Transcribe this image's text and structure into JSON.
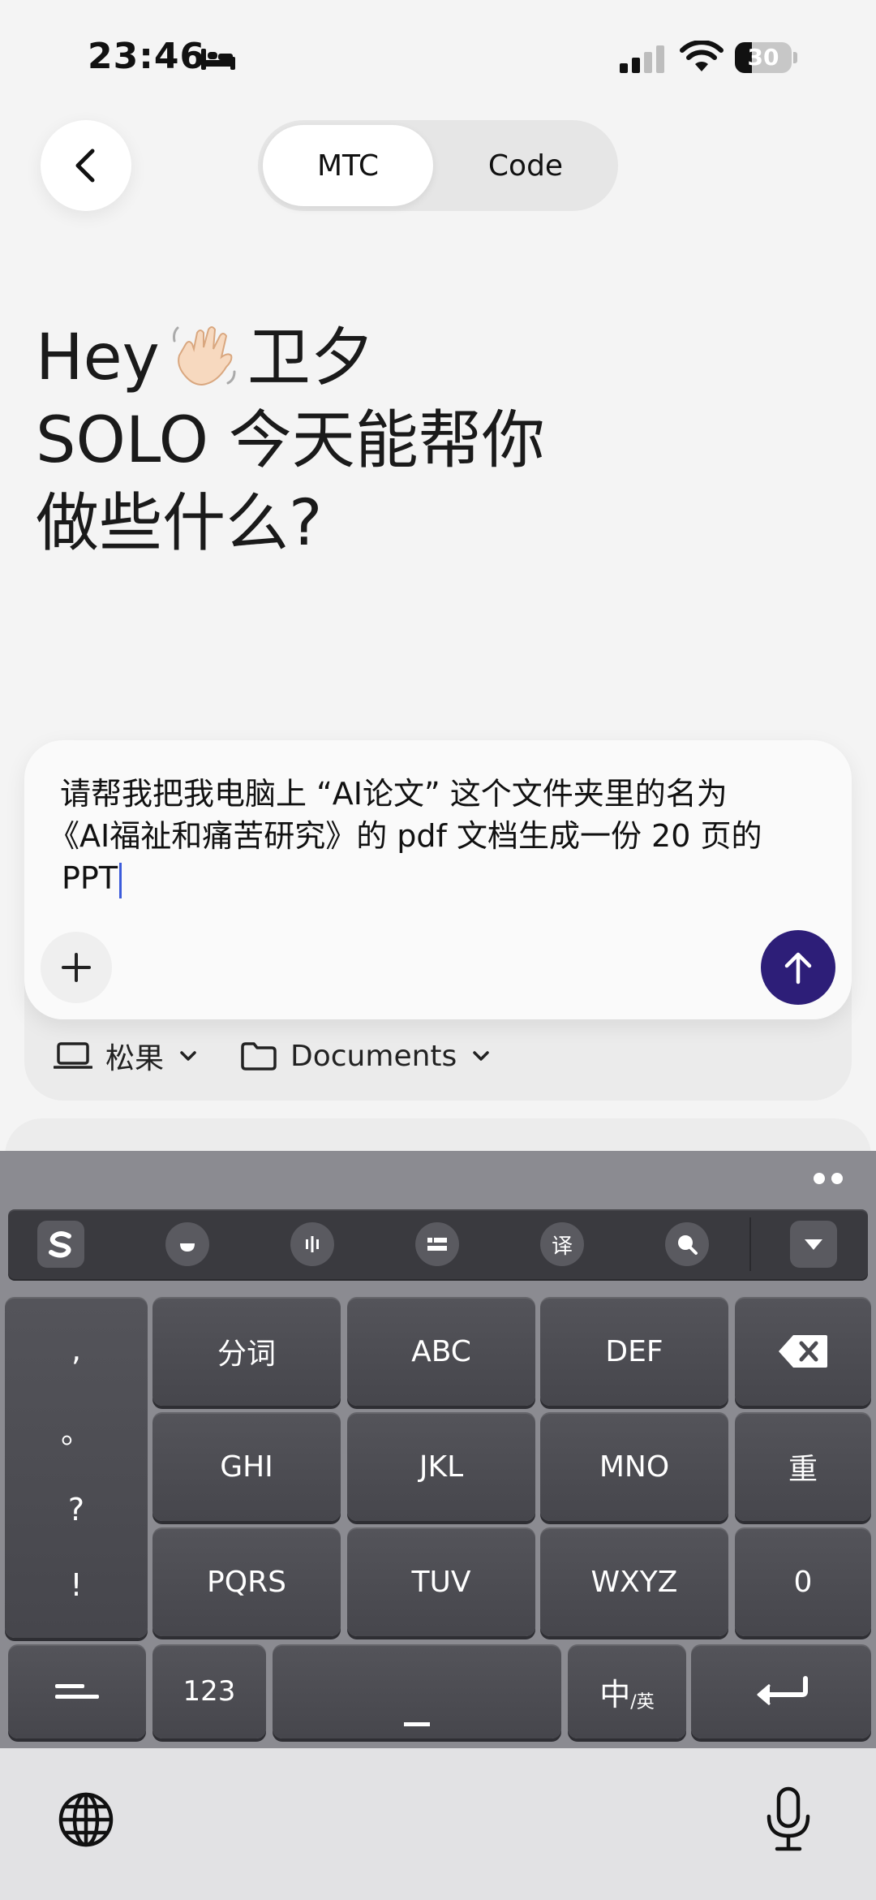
{
  "status_bar": {
    "time": "23:46",
    "battery": "30",
    "battery_level": 0.3
  },
  "header": {
    "tabs": [
      {
        "label": "MTC",
        "selected": true
      },
      {
        "label": "Code",
        "selected": false
      }
    ]
  },
  "greeting": {
    "line1": "Hey",
    "name": "卫夕",
    "line2": "SOLO 今天能帮你",
    "line3": "做些什么?"
  },
  "composer": {
    "text_line1": "请帮我把我电脑上 “AI论文” 这个文件夹里的名为",
    "text_line2": "《AI福祉和痛苦研究》的 pdf 文档生成一份 20 页的",
    "text_line3": "PPT",
    "device_label": "松果",
    "folder_label": "Documents"
  },
  "keyboard": {
    "toolbar": [
      "sogou-icon",
      "emoji-icon",
      "voice-icon",
      "clipboard-icon",
      "译",
      "search-icon",
      "collapse-icon"
    ],
    "punct": [
      ",",
      "。",
      "?",
      "!"
    ],
    "rows": [
      [
        "分词",
        "ABC",
        "DEF"
      ],
      [
        "GHI",
        "JKL",
        "MNO"
      ],
      [
        "PQRS",
        "TUV",
        "WXYZ"
      ]
    ],
    "retype": "重",
    "zero": "0",
    "num": "123",
    "lang_main": "中",
    "lang_sub": "/英"
  },
  "colors": {
    "send_button": "#2d1e78",
    "keyboard_key": "#4b4b51",
    "cursor": "#3b5bdb"
  }
}
